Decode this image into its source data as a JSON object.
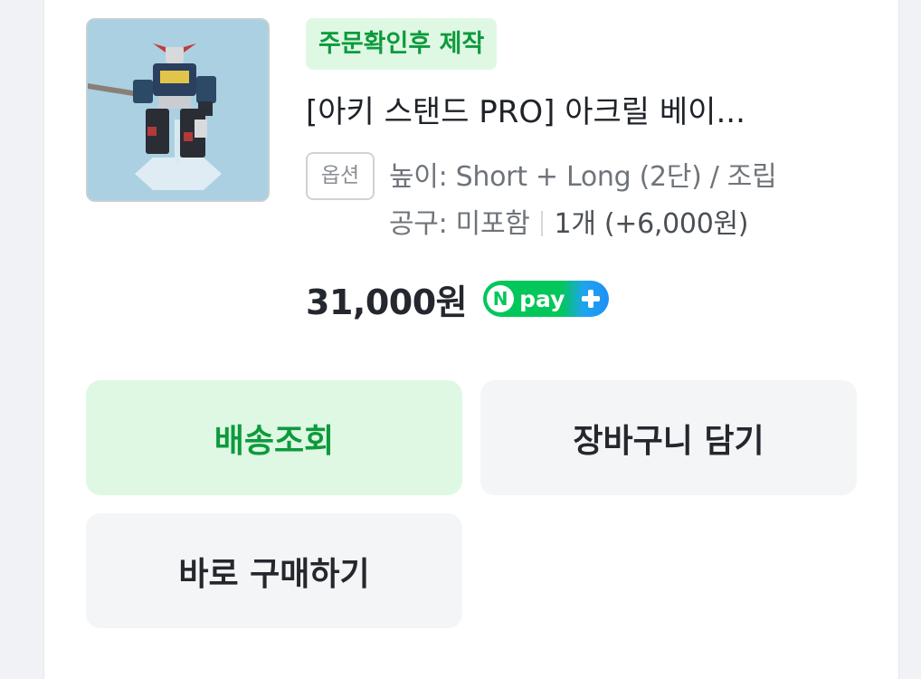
{
  "product": {
    "badge": "주문확인후 제작",
    "title": "[아키 스탠드 PRO] 아크릴 베이...",
    "option_chip": "옵션",
    "option_line1": "높이: Short + Long (2단) / 조립",
    "option_line2": "공구: 미포함",
    "quantity_text": "1개 (+6,000원)",
    "price": "31,000원",
    "thumbnail_icon": "robot-figure-image"
  },
  "npay": {
    "n_letter": "N",
    "pay_word": "pay",
    "icon": "plus-icon"
  },
  "actions": {
    "track_label": "배송조회",
    "cart_label": "장바구니 담기",
    "buy_label": "바로 구매하기"
  },
  "colors": {
    "accent_green": "#0e9a3c",
    "badge_bg": "#def8e4",
    "npay_green": "#03c75a",
    "npay_blue": "#1e90f5"
  }
}
